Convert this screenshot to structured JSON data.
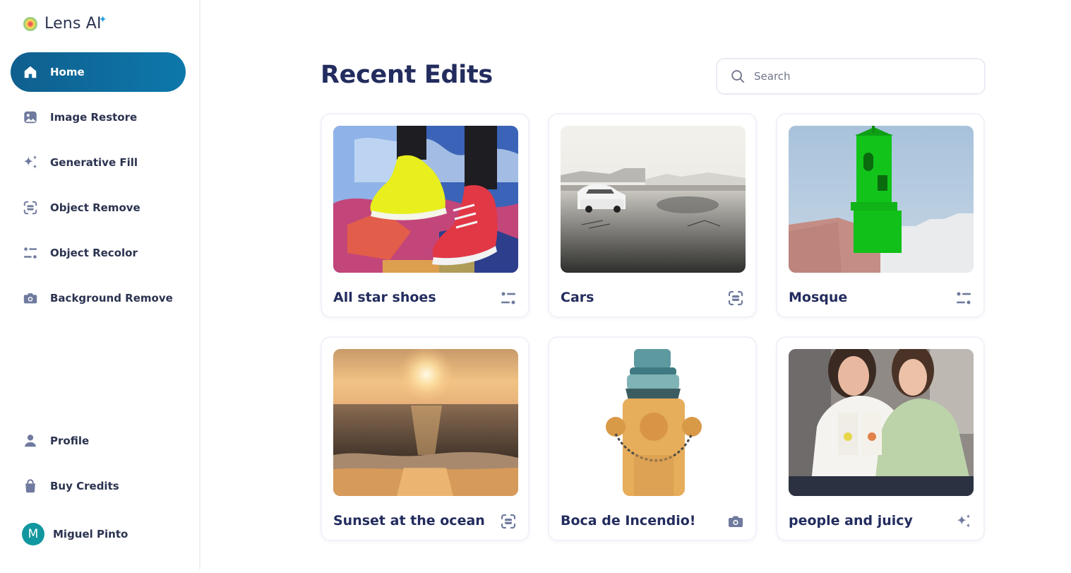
{
  "app": {
    "name": "Lens AI",
    "accent": "#0d6fa3"
  },
  "sidebar": {
    "items": [
      {
        "label": "Home",
        "icon": "home-icon",
        "active": true
      },
      {
        "label": "Image Restore",
        "icon": "image-icon"
      },
      {
        "label": "Generative Fill",
        "icon": "sparkles-icon"
      },
      {
        "label": "Object Remove",
        "icon": "scan-icon"
      },
      {
        "label": "Object Recolor",
        "icon": "sliders-icon"
      },
      {
        "label": "Background Remove",
        "icon": "camera-icon"
      }
    ],
    "bottom_items": [
      {
        "label": "Profile",
        "icon": "user-icon"
      },
      {
        "label": "Buy Credits",
        "icon": "bag-icon"
      }
    ],
    "user": {
      "initial": "M",
      "name": "Miguel Pinto",
      "avatar_color": "#11979f"
    }
  },
  "main": {
    "title": "Recent Edits",
    "search": {
      "placeholder": "Search",
      "value": ""
    },
    "cards": [
      {
        "title": "All star shoes",
        "tool_icon": "sliders-icon"
      },
      {
        "title": "Cars",
        "tool_icon": "scan-icon"
      },
      {
        "title": "Mosque",
        "tool_icon": "sliders-icon"
      },
      {
        "title": "Sunset at the ocean",
        "tool_icon": "scan-icon"
      },
      {
        "title": "Boca de Incendio!",
        "tool_icon": "camera-icon"
      },
      {
        "title": "people and juicy",
        "tool_icon": "sparkles-icon"
      }
    ]
  }
}
